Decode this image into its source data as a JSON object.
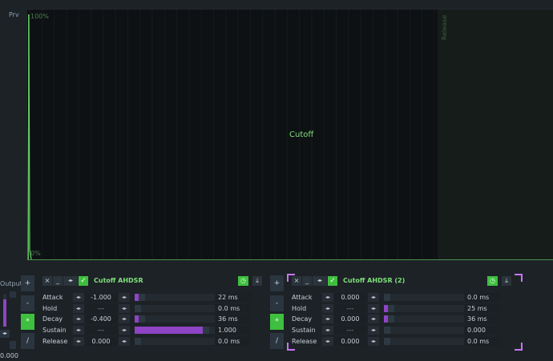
{
  "left_strip": {
    "prv_label": "Prv",
    "output_label": "Output",
    "output_value": "0.000",
    "output_button": "◂▸",
    "output_level": 0.85
  },
  "graph": {
    "title": "Cutoff",
    "label_top": "100%",
    "label_bottom": "0%",
    "release_label": "Release"
  },
  "op_buttons": [
    "+",
    "-",
    "*",
    "/"
  ],
  "op_active_index": 2,
  "panels": [
    {
      "title": "Cutoff AHDSR",
      "selected": false,
      "rows": [
        {
          "label": "Attack",
          "value": "-1.000",
          "fill": 0.05,
          "ms": "22 ms"
        },
        {
          "label": "Hold",
          "value": "---",
          "fill": 0.0,
          "ms": "0.0 ms"
        },
        {
          "label": "Decay",
          "value": "-0.400",
          "fill": 0.05,
          "ms": "36 ms"
        },
        {
          "label": "Sustain",
          "value": "---",
          "fill": 0.92,
          "ms": "1.000"
        },
        {
          "label": "Release",
          "value": "0.000",
          "fill": 0.0,
          "ms": "0.0 ms"
        }
      ]
    },
    {
      "title": "Cutoff AHDSR (2)",
      "selected": true,
      "rows": [
        {
          "label": "Attack",
          "value": "0.000",
          "fill": 0.0,
          "ms": "0.0 ms"
        },
        {
          "label": "Hold",
          "value": "---",
          "fill": 0.05,
          "ms": "25 ms"
        },
        {
          "label": "Decay",
          "value": "0.000",
          "fill": 0.05,
          "ms": "36 ms"
        },
        {
          "label": "Sustain",
          "value": "---",
          "fill": 0.0,
          "ms": "0.000"
        },
        {
          "label": "Release",
          "value": "0.000",
          "fill": 0.0,
          "ms": "0.0 ms"
        }
      ]
    }
  ],
  "icons": {
    "close": "×",
    "minimize": "_",
    "arrows": "◂▸",
    "check": "✓",
    "clock": "◷",
    "export": "⤓"
  },
  "colors": {
    "accent_green": "#3fbf3f",
    "title_green": "#7fe07a",
    "slider_purple": "#8e44c4",
    "selection_purple": "#c476f2"
  }
}
